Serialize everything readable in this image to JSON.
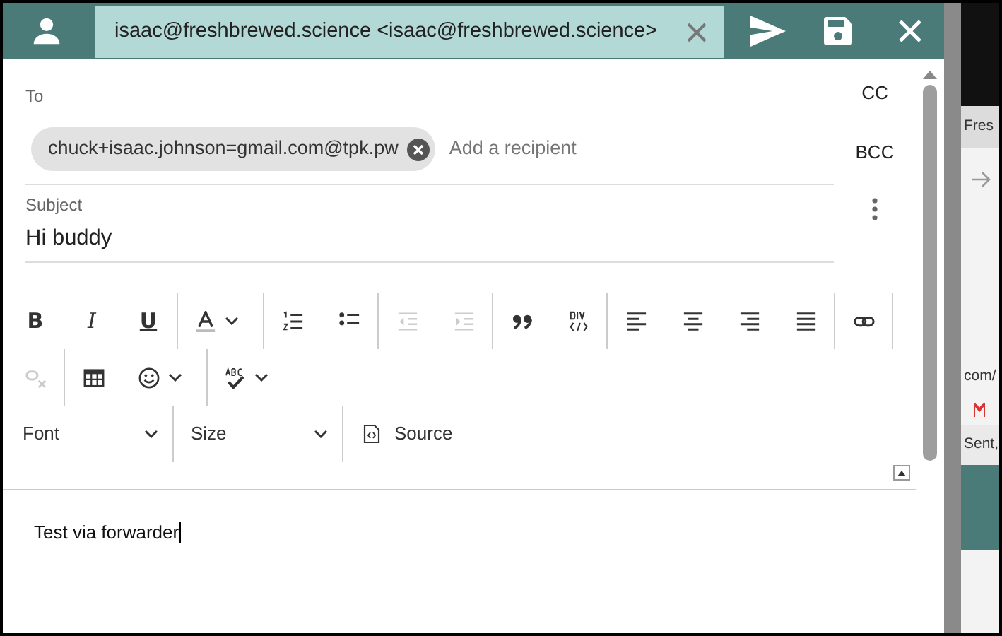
{
  "header": {
    "tab_title": "isaac@freshbrewed.science <isaac@freshbrewed.science>"
  },
  "recipients": {
    "label": "To",
    "chips": [
      {
        "address": "chuck+isaac.johnson=gmail.com@tpk.pw"
      }
    ],
    "placeholder": "Add a recipient"
  },
  "side_actions": [
    "CC",
    "BCC"
  ],
  "subject": {
    "label": "Subject",
    "value": "Hi buddy"
  },
  "toolbar": {
    "rows": [
      [
        [
          {
            "kind": "bold",
            "label": "B",
            "disabled": false,
            "dropdown": false
          },
          {
            "kind": "italic",
            "label": "I",
            "disabled": false,
            "dropdown": false
          },
          {
            "kind": "underline",
            "label": "U",
            "disabled": false,
            "dropdown": false
          }
        ],
        [
          {
            "kind": "textcolor",
            "disabled": false,
            "dropdown": true
          }
        ],
        [
          {
            "kind": "numlist",
            "disabled": false,
            "dropdown": false
          },
          {
            "kind": "bullist",
            "disabled": false,
            "dropdown": false
          }
        ],
        [
          {
            "kind": "outdent",
            "disabled": true,
            "dropdown": false
          },
          {
            "kind": "indent",
            "disabled": true,
            "dropdown": false
          }
        ],
        [
          {
            "kind": "blockquote",
            "disabled": false,
            "dropdown": false
          },
          {
            "kind": "div",
            "disabled": false,
            "dropdown": false
          }
        ],
        [
          {
            "kind": "alignleft",
            "disabled": false,
            "dropdown": false
          },
          {
            "kind": "aligncenter",
            "disabled": false,
            "dropdown": false
          },
          {
            "kind": "alignright",
            "disabled": false,
            "dropdown": false
          },
          {
            "kind": "justify",
            "disabled": false,
            "dropdown": false
          }
        ],
        [
          {
            "kind": "link",
            "disabled": false,
            "dropdown": false
          }
        ]
      ],
      [
        [
          {
            "kind": "unlink",
            "disabled": true,
            "dropdown": false
          }
        ],
        [
          {
            "kind": "table",
            "disabled": false,
            "dropdown": false
          },
          {
            "kind": "emoji",
            "disabled": false,
            "dropdown": true
          }
        ],
        [
          {
            "kind": "spellcheck",
            "disabled": false,
            "dropdown": true
          }
        ]
      ]
    ]
  },
  "format_bar": [
    {
      "kind": "select",
      "label": "Font"
    },
    {
      "kind": "select",
      "label": "Size"
    },
    {
      "kind": "source",
      "label": "Source"
    }
  ],
  "body_text": "Test via forwarder",
  "background_window": {
    "texts": [
      "Fres",
      "com/",
      "Sent,"
    ]
  }
}
